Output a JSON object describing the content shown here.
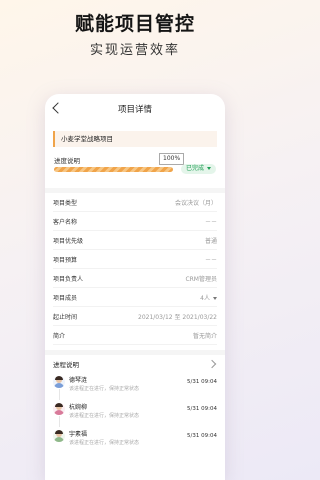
{
  "headline": {
    "title": "赋能项目管控",
    "subtitle": "实现运营效率"
  },
  "nav": {
    "title": "项目详情"
  },
  "project": {
    "name": "小麦学堂战略项目"
  },
  "progress": {
    "label": "进度说明",
    "percent_text": "100%",
    "percent": 100,
    "status": "已完成"
  },
  "fields": [
    {
      "key": "项目类型",
      "value": "会议决议（月）"
    },
    {
      "key": "客户名称",
      "value": "－－"
    },
    {
      "key": "项目优先级",
      "value": "普通"
    },
    {
      "key": "项目预算",
      "value": "－－"
    },
    {
      "key": "项目负责人",
      "value": "CRM管理员"
    },
    {
      "key": "项目成员",
      "value": "4人"
    },
    {
      "key": "起止时间",
      "value": "2021/03/12 至 2021/03/22"
    },
    {
      "key": "简介",
      "value": "暂无简介"
    }
  ],
  "progress_log": {
    "title": "进程说明",
    "entries": [
      {
        "name": "德琴涟",
        "note": "该进程正在进行，保持正常状态",
        "time": "5/31 09:04",
        "color": "#7a9ed8"
      },
      {
        "name": "杭婉柳",
        "note": "该进程正在进行，保持正常状态",
        "time": "5/31 09:04",
        "color": "#d87a9a"
      },
      {
        "name": "宇素福",
        "note": "该进程正在进行，保持正常状态",
        "time": "5/31 09:04",
        "color": "#8fb88a"
      }
    ]
  },
  "colors": {
    "accent": "#f0a44a",
    "success": "#1f9e55"
  }
}
